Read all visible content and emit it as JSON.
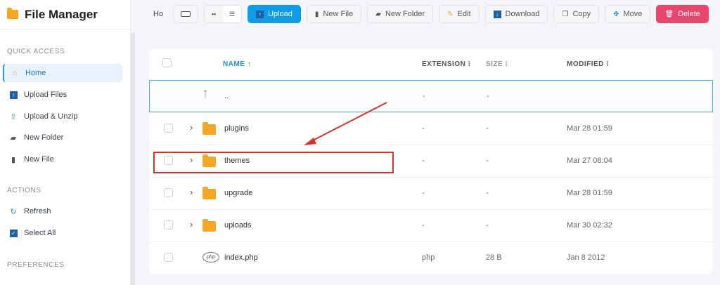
{
  "app": {
    "title": "File Manager"
  },
  "sidebar": {
    "sections": [
      {
        "title": "QUICK ACCESS"
      },
      {
        "title": "ACTIONS"
      },
      {
        "title": "PREFERENCES"
      }
    ],
    "quick_access": [
      {
        "label": "Home",
        "icon": "home-icon"
      },
      {
        "label": "Upload Files",
        "icon": "upload-icon"
      },
      {
        "label": "Upload & Unzip",
        "icon": "upload-unzip-icon"
      },
      {
        "label": "New Folder",
        "icon": "new-folder-icon"
      },
      {
        "label": "New File",
        "icon": "new-file-icon"
      }
    ],
    "actions": [
      {
        "label": "Refresh",
        "icon": "refresh-icon"
      },
      {
        "label": "Select All",
        "icon": "checkbox-icon"
      }
    ]
  },
  "toolbar": {
    "path_text": "Ho",
    "upload": "Upload",
    "new_file": "New File",
    "new_folder": "New Folder",
    "edit": "Edit",
    "download": "Download",
    "copy": "Copy",
    "move": "Move",
    "delete": "Delete"
  },
  "table": {
    "columns": {
      "name": "NAME ↑",
      "extension": "EXTENSION ⁝",
      "size": "SIZE ⁝",
      "modified": "MODIFIED ⁝"
    },
    "parent_row": {
      "name": "..",
      "extension": "-",
      "size": "-"
    },
    "rows": [
      {
        "name": "plugins",
        "extension": "-",
        "size": "-",
        "modified": "Mar 28 01:59"
      },
      {
        "name": "themes",
        "extension": "-",
        "size": "-",
        "modified": "Mar 27 08:04"
      },
      {
        "name": "upgrade",
        "extension": "-",
        "size": "-",
        "modified": "Mar 28 01:59"
      },
      {
        "name": "uploads",
        "extension": "-",
        "size": "-",
        "modified": "Mar 30 02:32"
      },
      {
        "name": "index.php",
        "extension": "php",
        "size": "28 B",
        "modified": "Jan 8 2012",
        "icon_text": "php"
      }
    ]
  },
  "colors": {
    "accent": "#0f9be8",
    "danger": "#e8466c",
    "folder": "#f5a623",
    "annotation": "#d9342b"
  }
}
